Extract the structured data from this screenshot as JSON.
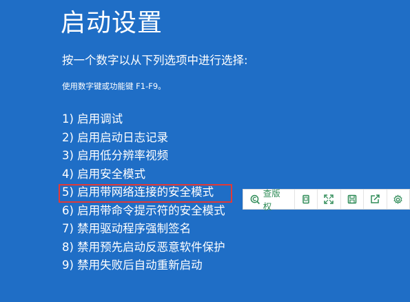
{
  "header": {
    "title": "启动设置",
    "prompt": "按一个数字以从下列选项中进行选择:",
    "hint": "使用数字键或功能键 F1-F9。"
  },
  "options": [
    {
      "label": "1) 启用调试"
    },
    {
      "label": "2) 启用启动日志记录"
    },
    {
      "label": "3) 启用低分辨率视频"
    },
    {
      "label": "4) 启用安全模式"
    },
    {
      "label": "5) 启用带网络连接的安全模式"
    },
    {
      "label": "6) 启用带命令提示符的安全模式"
    },
    {
      "label": "7) 禁用驱动程序强制签名"
    },
    {
      "label": "8) 禁用预先启动反恶意软件保护"
    },
    {
      "label": "9) 禁用失败后自动重新启动"
    }
  ],
  "highlighted_option_index": 4,
  "toolbar": {
    "check_label": "查版权",
    "icons": [
      "copyright-search-icon",
      "copy-icon",
      "expand-icon",
      "save-icon",
      "share-icon",
      "gear-icon"
    ]
  },
  "colors": {
    "background": "#1f6ec6",
    "highlight": "#e53935",
    "toolbar_accent": "#2e8b57"
  }
}
